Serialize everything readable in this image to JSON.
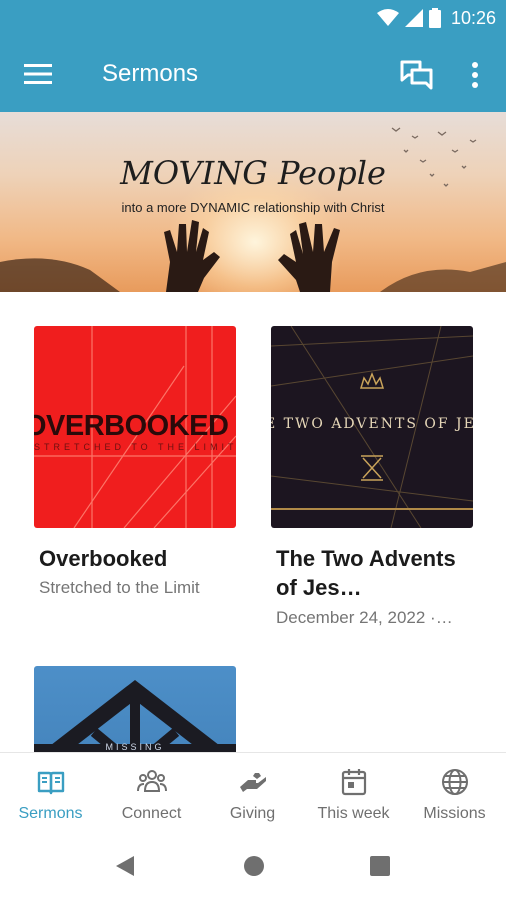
{
  "status_bar": {
    "time": "10:26"
  },
  "app_bar": {
    "title": "Sermons"
  },
  "banner": {
    "title": "MOVING People",
    "subtitle": "into a more DYNAMIC relationship with Christ"
  },
  "sermons": [
    {
      "title": "Overbooked",
      "subtitle": "Stretched to the Limit",
      "art_text": "OVERBOOKED",
      "art_subtext": "STRETCHED TO THE LIMIT"
    },
    {
      "title": "The Two Advents of Jes…",
      "subtitle": "December 24, 2022 ·…",
      "art_text": "E TWO ADVENTS OF JE"
    },
    {
      "art_text": "MISSING"
    }
  ],
  "bottom_nav": [
    {
      "label": "Sermons",
      "icon": "book-icon",
      "active": true
    },
    {
      "label": "Connect",
      "icon": "people-icon",
      "active": false
    },
    {
      "label": "Giving",
      "icon": "giving-hand-icon",
      "active": false
    },
    {
      "label": "This week",
      "icon": "calendar-icon",
      "active": false
    },
    {
      "label": "Missions",
      "icon": "globe-icon",
      "active": false
    }
  ],
  "colors": {
    "primary": "#3a9ec2",
    "inactive": "#6f6f6f"
  }
}
